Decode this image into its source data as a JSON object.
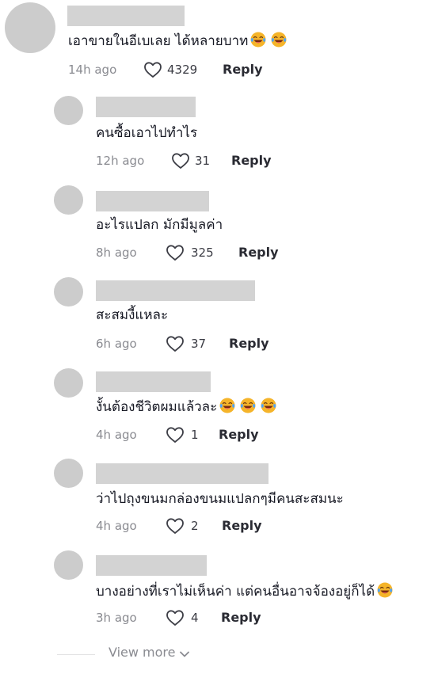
{
  "comments": [
    {
      "text": "เอาขายในอีเบเลย ได้หลายบาท",
      "emoji_count": 2,
      "time": "14h ago",
      "likes": "4329",
      "reply": "Reply"
    },
    {
      "text": "คนซื้อเอาไปทำไร",
      "emoji_count": 0,
      "time": "12h ago",
      "likes": "31",
      "reply": "Reply"
    },
    {
      "text": "อะไรแปลก มักมีมูลค่า",
      "emoji_count": 0,
      "time": "8h ago",
      "likes": "325",
      "reply": "Reply"
    },
    {
      "text": "สะสมงี้แหละ",
      "emoji_count": 0,
      "time": "6h ago",
      "likes": "37",
      "reply": "Reply"
    },
    {
      "text": "งั้นต้องชีวิตผมแล้วละ",
      "emoji_count": 3,
      "time": "4h ago",
      "likes": "1",
      "reply": "Reply"
    },
    {
      "text": "ว่าไปถุงขนมกล่องขนมแปลกๆมีคนสะสมนะ",
      "emoji_count": 0,
      "time": "4h ago",
      "likes": "2",
      "reply": "Reply"
    },
    {
      "text": "บางอย่างที่เราไม่เห็นค่า แต่คนอื่นอาจจ้องอยู่ก็ได้",
      "emoji_count": 1,
      "time": "3h ago",
      "likes": "4",
      "reply": "Reply"
    }
  ],
  "footer": {
    "view_more": "View more"
  },
  "icons": {
    "like": "heart-outline-icon",
    "emoji": "laughing-tears-emoji-icon",
    "expand": "chevron-down-icon"
  },
  "colors": {
    "text": "#161823",
    "meta": "#8a8b91",
    "placeholder": "#d3d3d3",
    "avatar": "#cccccc",
    "emoji": "#f5b42a"
  }
}
